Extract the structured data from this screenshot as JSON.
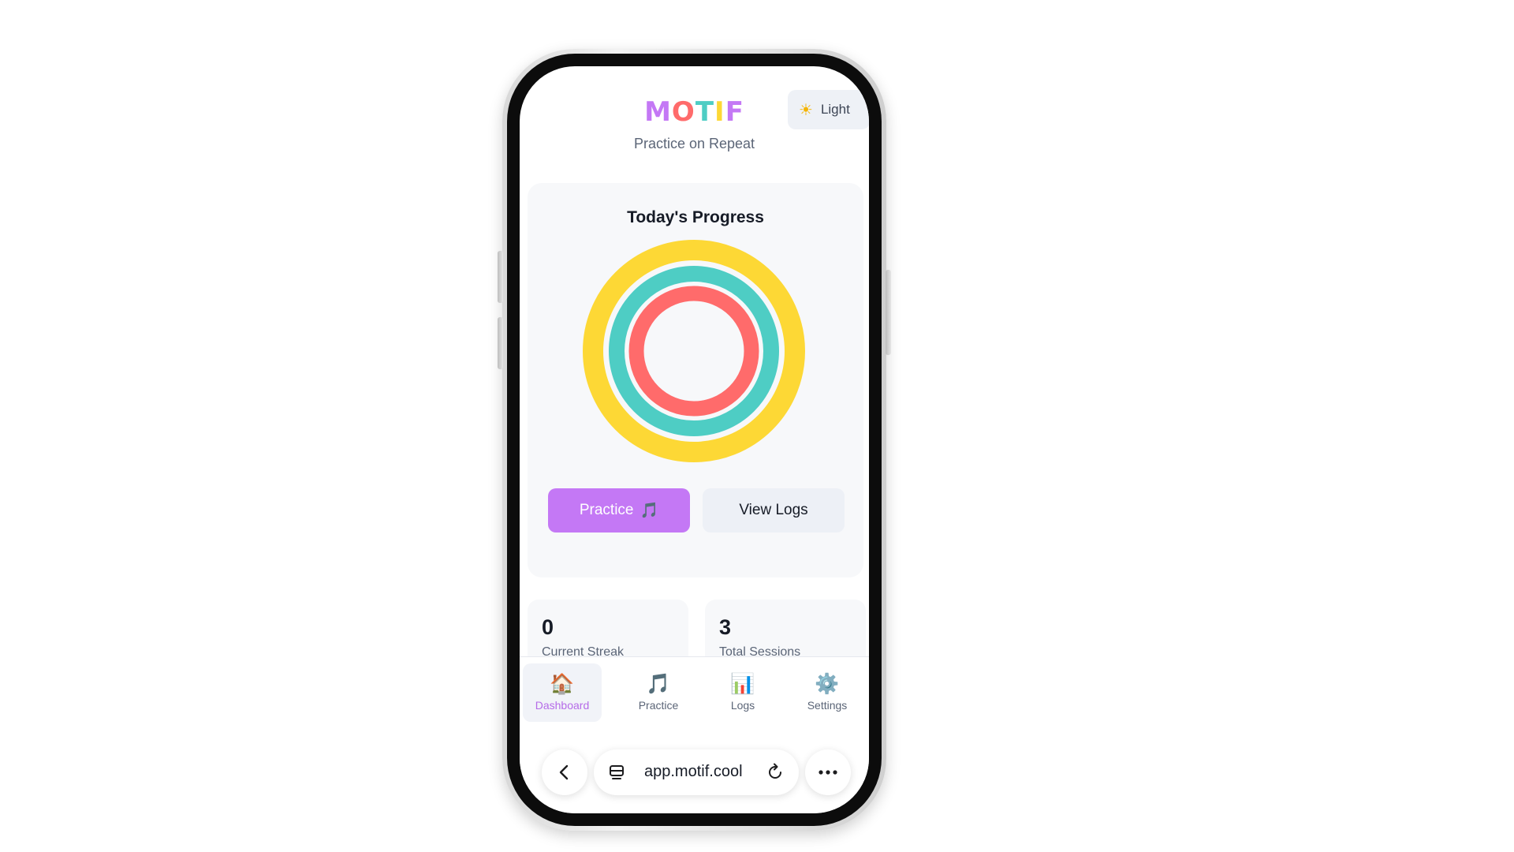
{
  "header": {
    "logo_letters": [
      "M",
      "O",
      "T",
      "I",
      "F"
    ],
    "subtitle": "Practice on Repeat",
    "theme_toggle": {
      "icon": "sun-icon",
      "label": "Light"
    }
  },
  "progress": {
    "title": "Today's Progress",
    "rings": [
      {
        "name": "outer",
        "color": "#FDD835"
      },
      {
        "name": "middle",
        "color": "#4ECDC4"
      },
      {
        "name": "inner",
        "color": "#FF6B6B"
      }
    ],
    "practice_button": {
      "label": "Practice",
      "icon": "🎵"
    },
    "logs_button": {
      "label": "View Logs"
    }
  },
  "stats": [
    {
      "value": "0",
      "label": "Current Streak"
    },
    {
      "value": "3",
      "label": "Total Sessions"
    }
  ],
  "nav": [
    {
      "icon": "🏠",
      "label": "Dashboard",
      "active": true
    },
    {
      "icon": "🎵",
      "label": "Practice",
      "active": false
    },
    {
      "icon": "📊",
      "label": "Logs",
      "active": false
    },
    {
      "icon": "⚙️",
      "label": "Settings",
      "active": false
    }
  ],
  "browser": {
    "url": "app.motif.cool"
  },
  "colors": {
    "accent": "#C478F5",
    "logo": [
      "#C478F5",
      "#FF6B6B",
      "#4ECDC4",
      "#FDD835",
      "#C478F5"
    ]
  }
}
